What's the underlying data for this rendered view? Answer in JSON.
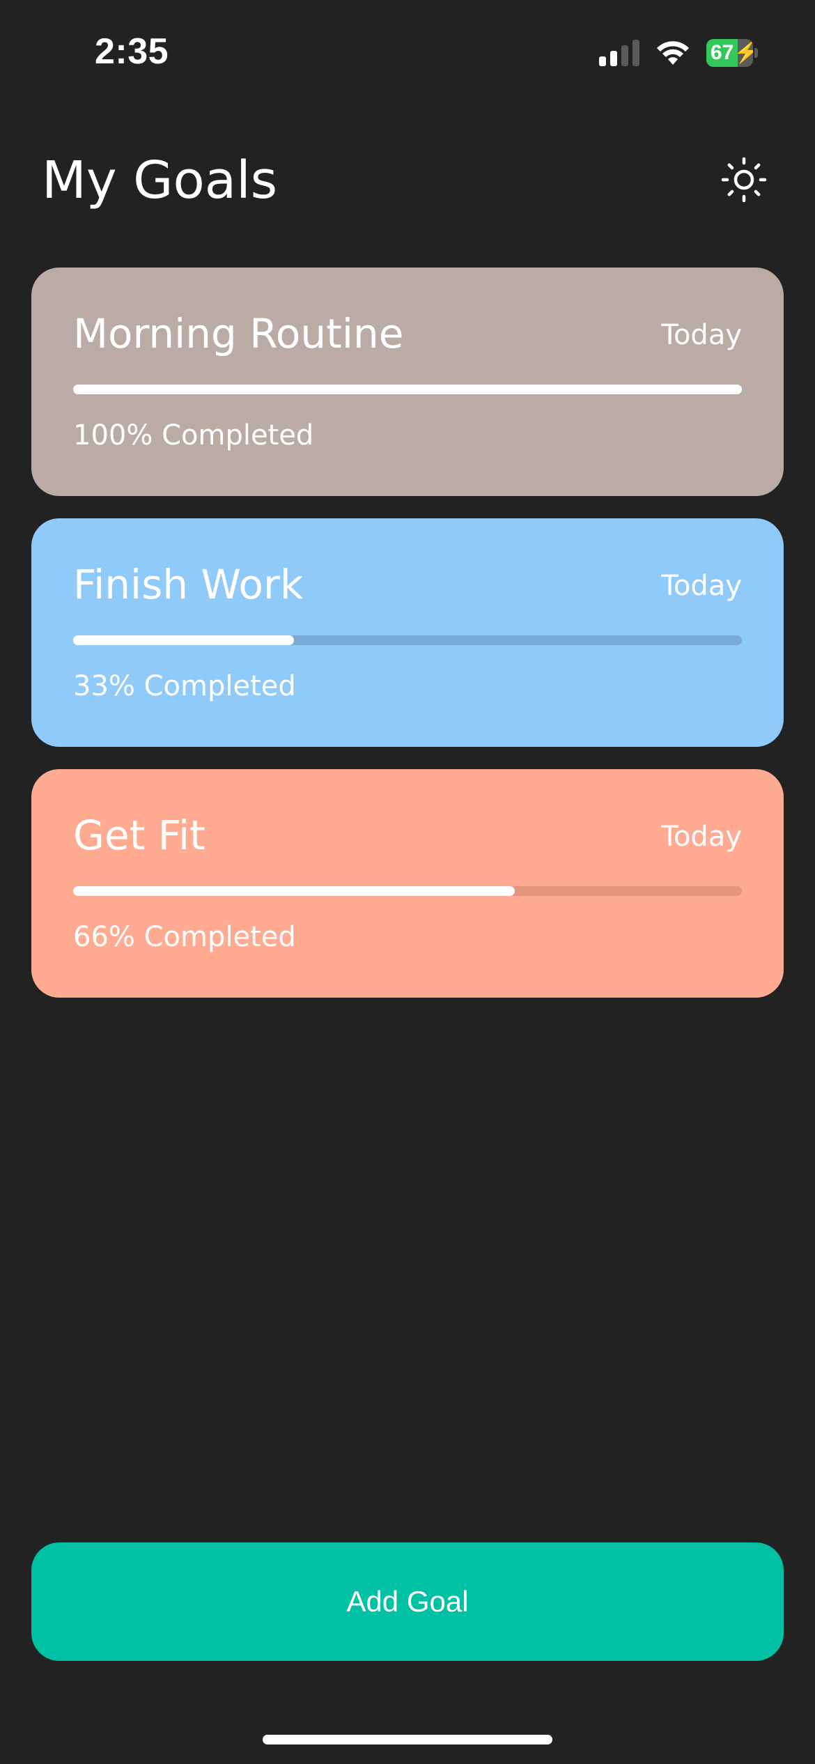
{
  "status_bar": {
    "time": "2:35",
    "battery_level": "67",
    "battery_charging": true,
    "battery_color": "#34c759",
    "signal_bars_active": 2,
    "signal_bars_total": 4,
    "icons": [
      "cellular-signal-icon",
      "wifi-icon",
      "battery-charging-icon"
    ]
  },
  "header": {
    "title": "My Goals",
    "theme_icon": "sun-icon"
  },
  "goals": [
    {
      "title": "Morning Routine",
      "date": "Today",
      "progress": 1.0,
      "status": "100% Completed",
      "color": "#bbaba5",
      "track_color": "#a89894"
    },
    {
      "title": "Finish Work",
      "date": "Today",
      "progress": 0.33,
      "status": "33% Completed",
      "color": "#90caf9",
      "track_color": "#7aaad6"
    },
    {
      "title": "Get Fit",
      "date": "Today",
      "progress": 0.66,
      "status": "66% Completed",
      "color": "#ffab91",
      "track_color": "#e3957f"
    }
  ],
  "add_button": {
    "label": "Add Goal",
    "color": "#00c1a3"
  }
}
